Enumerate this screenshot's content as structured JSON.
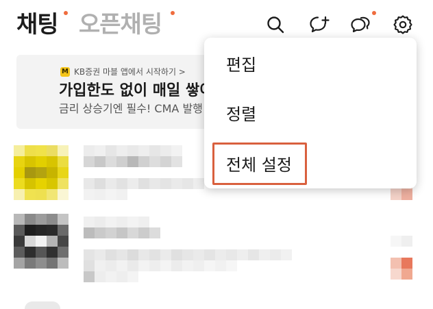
{
  "header": {
    "tab_chat": "채팅",
    "tab_open_chat": "오픈채팅",
    "accent": "#ef6c3e",
    "icons": [
      "search-icon",
      "new-chat-icon",
      "open-chat-icon",
      "settings-icon"
    ]
  },
  "ad": {
    "badge": "M",
    "source": "KB증권 마블 앱에서 시작하기 >",
    "title": "가입한도 없이 매일 쌓이",
    "description": "금리 상승기엔 필수! CMA 발행"
  },
  "menu": {
    "items": [
      "편집",
      "정렬",
      "전체 설정"
    ],
    "highlighted": "전체 설정",
    "highlight_color": "#d9603e"
  }
}
